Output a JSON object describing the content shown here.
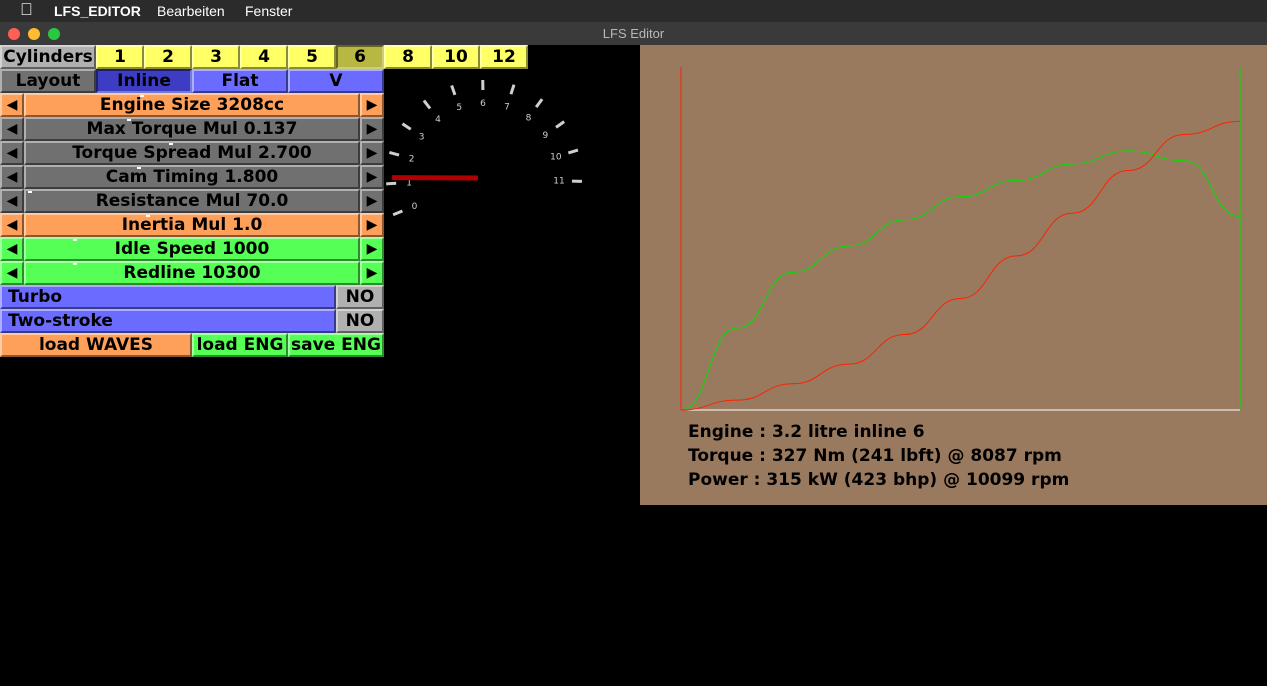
{
  "menubar": {
    "apple_icon": "apple-logo-icon",
    "app": "LFS_EDITOR",
    "edit": "Bearbeiten",
    "window": "Fenster"
  },
  "window": {
    "title": "LFS Editor"
  },
  "cylinders": {
    "label": "Cylinders",
    "options": [
      "1",
      "2",
      "3",
      "4",
      "5",
      "6",
      "8",
      "10",
      "12"
    ],
    "selected": "6"
  },
  "layout": {
    "label": "Layout",
    "options": [
      "Inline",
      "Flat",
      "V"
    ],
    "selected": "Inline"
  },
  "sliders": [
    {
      "label": "Engine Size 3208cc",
      "color": "#ffa05a",
      "knob": 0.35
    },
    {
      "label": "Max Torque Mul 0.137",
      "color": "#707070",
      "knob": 0.31
    },
    {
      "label": "Torque Spread Mul 2.700",
      "color": "#707070",
      "knob": 0.44
    },
    {
      "label": "Cam Timing 1.800",
      "color": "#707070",
      "knob": 0.34
    },
    {
      "label": "Resistance Mul 70.0",
      "color": "#707070",
      "knob": 0.0
    },
    {
      "label": "Inertia Mul 1.0",
      "color": "#ffa05a",
      "knob": 0.37
    },
    {
      "label": "Idle Speed 1000",
      "color": "#55ff55",
      "knob": 0.14
    },
    {
      "label": "Redline 10300",
      "color": "#55ff55",
      "knob": 0.14
    }
  ],
  "toggles": [
    {
      "label": "Turbo",
      "value": "NO"
    },
    {
      "label": "Two-stroke",
      "value": "NO"
    }
  ],
  "buttons": {
    "load_waves": "load WAVES",
    "load_eng": "load ENG",
    "save_eng": "save ENG"
  },
  "tachometer": {
    "ticks": [
      "0",
      "1",
      "2",
      "3",
      "4",
      "5",
      "6",
      "7",
      "8",
      "9",
      "10",
      "11"
    ],
    "needle_value": 1.2
  },
  "engine_info": {
    "engine": "Engine : 3.2 litre inline 6",
    "torque": "Torque : 327 Nm (241 lbft) @ 8087 rpm",
    "power": "Power : 315 kW (423 bhp) @ 10099 rpm"
  },
  "chart_data": {
    "type": "line",
    "x": [
      0,
      1000,
      2000,
      3000,
      4000,
      5000,
      6000,
      7000,
      8000,
      9000,
      10000
    ],
    "series": [
      {
        "color": "#00e000",
        "values": [
          0,
          0.25,
          0.42,
          0.5,
          0.58,
          0.65,
          0.7,
          0.75,
          0.79,
          0.76,
          0.59
        ]
      },
      {
        "color": "#ff2000",
        "values": [
          0,
          0.03,
          0.08,
          0.14,
          0.23,
          0.34,
          0.47,
          0.6,
          0.73,
          0.84,
          0.88
        ]
      }
    ],
    "grid": false
  },
  "colors": {
    "graph_bg": "#9a7a5e",
    "torque": "#00e000",
    "power": "#ff2000"
  }
}
